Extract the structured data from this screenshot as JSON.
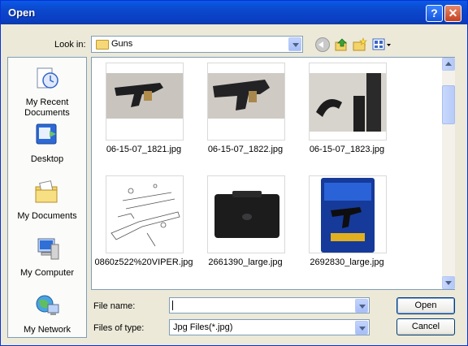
{
  "window": {
    "title": "Open"
  },
  "lookin": {
    "label": "Look in:",
    "value": "Guns"
  },
  "places": [
    {
      "label": "My Recent Documents",
      "icon": "recent-documents-icon"
    },
    {
      "label": "Desktop",
      "icon": "desktop-icon"
    },
    {
      "label": "My Documents",
      "icon": "my-documents-icon"
    },
    {
      "label": "My Computer",
      "icon": "my-computer-icon"
    },
    {
      "label": "My Network",
      "icon": "my-network-icon"
    }
  ],
  "files": [
    {
      "name": "06-15-07_1821.jpg"
    },
    {
      "name": "06-15-07_1822.jpg"
    },
    {
      "name": "06-15-07_1823.jpg"
    },
    {
      "name": "0860z522%20VIPER.jpg"
    },
    {
      "name": "2661390_large.jpg"
    },
    {
      "name": "2692830_large.jpg"
    }
  ],
  "filename": {
    "label": "File name:",
    "value": ""
  },
  "filetype": {
    "label": "Files of type:",
    "value": "Jpg Files(*.jpg)"
  },
  "buttons": {
    "open": "Open",
    "cancel": "Cancel"
  }
}
